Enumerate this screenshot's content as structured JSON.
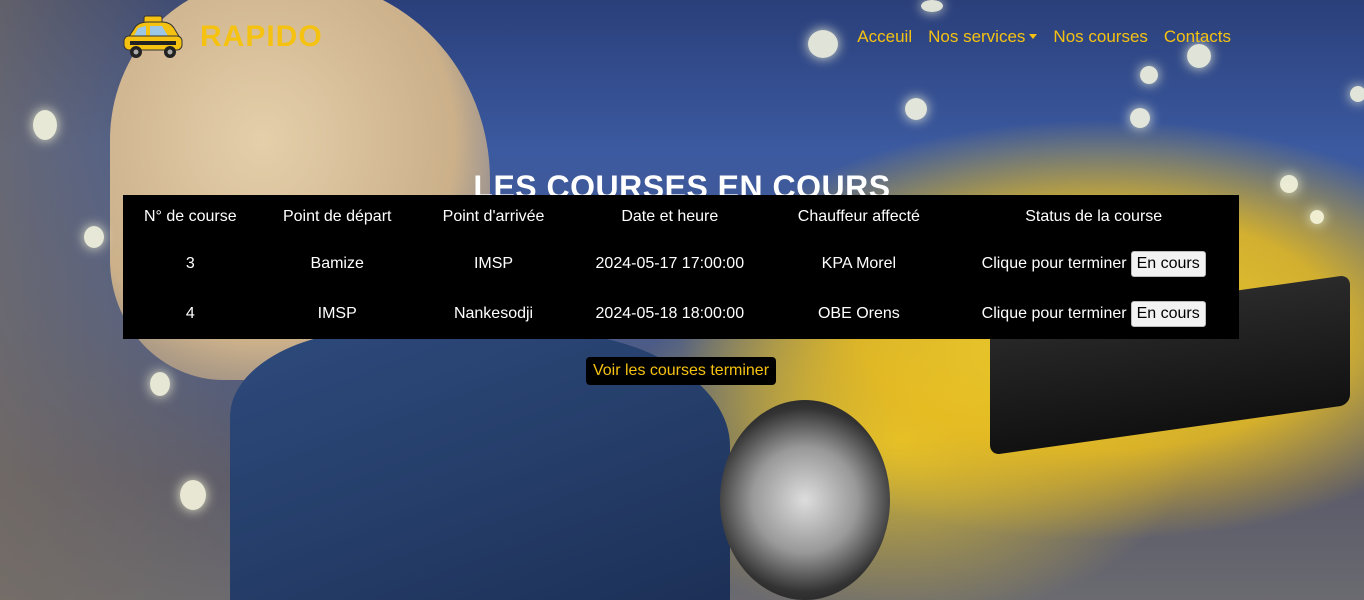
{
  "brand": {
    "name": "RAPIDO",
    "logo_icon": "taxi-icon"
  },
  "nav": {
    "items": [
      {
        "label": "Acceuil"
      },
      {
        "label": "Nos services",
        "dropdown": true
      },
      {
        "label": "Nos courses"
      },
      {
        "label": "Contacts"
      }
    ]
  },
  "page": {
    "title": "LES COURSES EN COURS"
  },
  "table": {
    "headers": [
      "N° de course",
      "Point de départ",
      "Point d'arrivée",
      "Date et heure",
      "Chauffeur affecté",
      "Status de la course"
    ],
    "rows": [
      {
        "num": "3",
        "depart": "Bamize",
        "arrivee": "IMSP",
        "datetime": "2024-05-17 17:00:00",
        "chauffeur": "KPA Morel",
        "status_text": "Clique pour terminer",
        "button": "En cours"
      },
      {
        "num": "4",
        "depart": "IMSP",
        "arrivee": "Nankesodji",
        "datetime": "2024-05-18 18:00:00",
        "chauffeur": "OBE Orens",
        "status_text": "Clique pour terminer",
        "button": "En cours"
      }
    ]
  },
  "actions": {
    "finished_label": "Voir les courses terminer"
  },
  "colors": {
    "accent": "#f5c211",
    "table_bg": "#000000"
  }
}
